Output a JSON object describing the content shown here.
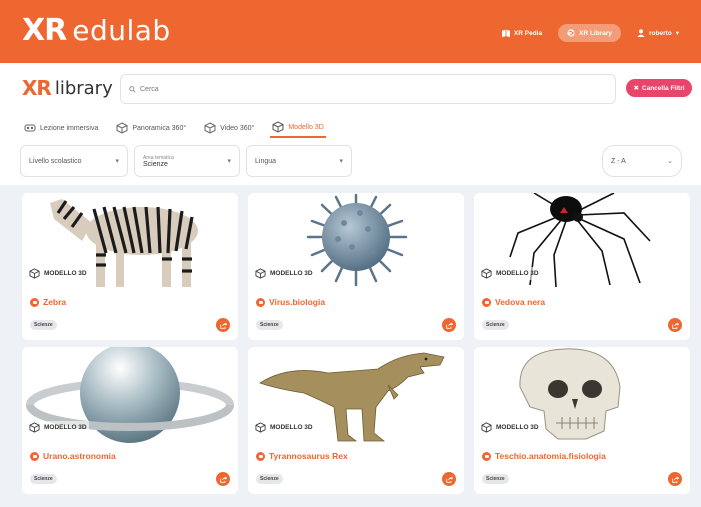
{
  "header": {
    "brand_xr": "XR",
    "brand_name": "edulab",
    "nav": [
      {
        "label": "XR Pedia",
        "icon": "book-icon"
      },
      {
        "label": "XR Library",
        "icon": "globe-icon"
      },
      {
        "label": "roberto",
        "icon": "user-icon"
      }
    ],
    "user_caret": "▾",
    "brand_color": "#ee6630"
  },
  "library": {
    "xr": "XR",
    "name": "library"
  },
  "search": {
    "placeholder": "Cerca"
  },
  "clear_filters": {
    "label": "Cancella Filtri",
    "color": "#e8456a"
  },
  "tabs": [
    {
      "label": "Lezione immersiva",
      "icon": "vr-icon"
    },
    {
      "label": "Panoramica 360°",
      "icon": "cube-360-icon"
    },
    {
      "label": "Video 360°",
      "icon": "video-360-icon"
    },
    {
      "label": "Modello 3D",
      "icon": "cube-icon",
      "active": true
    }
  ],
  "filters": {
    "level": "Livello scolastico",
    "area_label": "Area tematica",
    "area_value": "Scienze",
    "language": "Lingua",
    "sort": "Z - A"
  },
  "cards": [
    {
      "type": "MODELLO 3D",
      "title": "Zebra",
      "badge": "Scienze",
      "image": "zebra"
    },
    {
      "type": "MODELLO 3D",
      "title": "Virus.biologia",
      "badge": "Scienze",
      "image": "virus"
    },
    {
      "type": "MODELLO 3D",
      "title": "Vedova nera",
      "badge": "Scienze",
      "image": "spider"
    },
    {
      "type": "MODELLO 3D",
      "title": "Urano.astronomia",
      "badge": "Scienze",
      "image": "planet"
    },
    {
      "type": "MODELLO 3D",
      "title": "Tyrannosaurus Rex",
      "badge": "Scienze",
      "image": "t-rex"
    },
    {
      "type": "MODELLO 3D",
      "title": "Teschio.anatomia.fisiologia",
      "badge": "Scienze",
      "image": "skull"
    }
  ]
}
